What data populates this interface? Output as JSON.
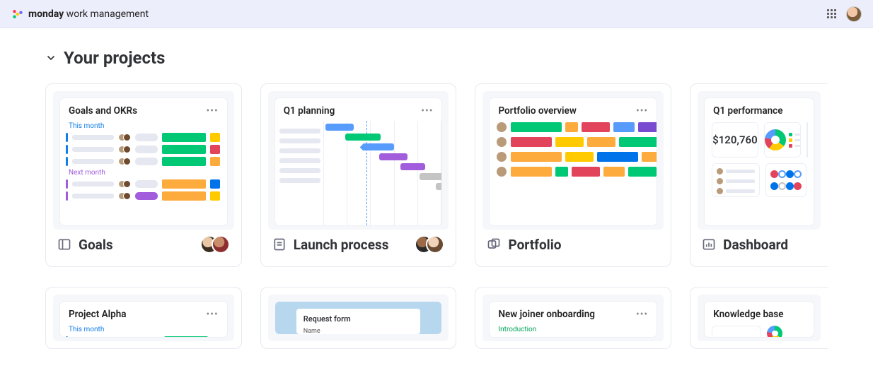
{
  "header": {
    "brand_bold": "monday",
    "brand_rest": " work management"
  },
  "section_title": "Your projects",
  "cards": [
    {
      "preview_title": "Goals and OKRs",
      "group1": "This month",
      "group2": "Next month",
      "footer": "Goals"
    },
    {
      "preview_title": "Q1 planning",
      "footer": "Launch process"
    },
    {
      "preview_title": "Portfolio overview",
      "footer": "Portfolio"
    },
    {
      "preview_title": "Q1 performance",
      "metric": "$120,760",
      "footer": "Dashboard"
    }
  ],
  "row2": {
    "alpha_title": "Project Alpha",
    "alpha_group": "This month",
    "form_title": "Request form",
    "form_field": "Name",
    "onboard_title": "New joiner onboarding",
    "onboard_group": "Introduction",
    "kb_title": "Knowledge base"
  },
  "colors": {
    "green": "#00c875",
    "orange": "#fdab3d",
    "red": "#e2445c",
    "yellow": "#ffcb00",
    "blue": "#579bfc",
    "navy": "#0073ea",
    "purple": "#a25ddc"
  }
}
